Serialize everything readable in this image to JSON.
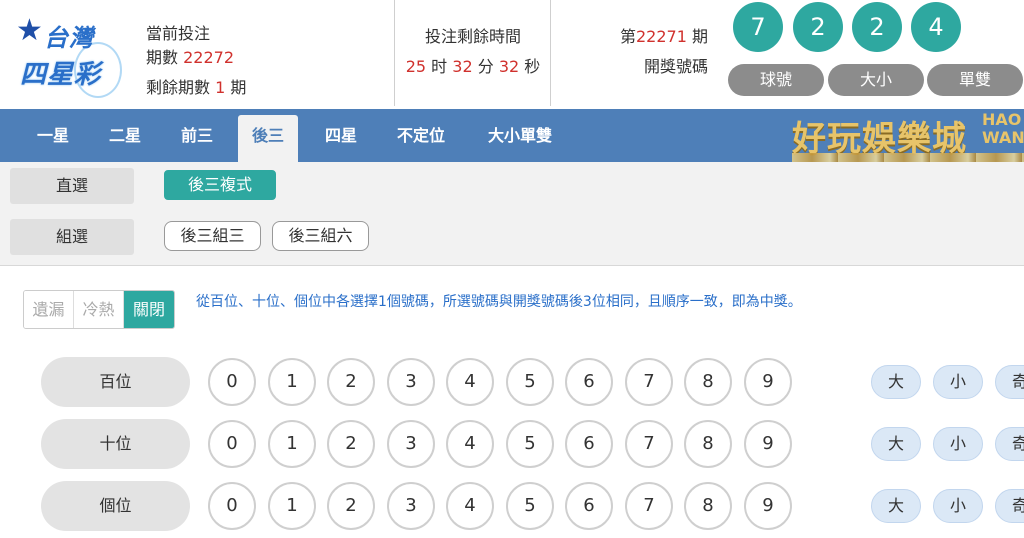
{
  "logo": {
    "line1": "台灣",
    "line2": "四星彩"
  },
  "current": {
    "label": "當前投注",
    "period_label": "期數",
    "period": "22272",
    "remaining_label": "剩餘期數",
    "remaining": "1",
    "remaining_unit": "期"
  },
  "timer": {
    "label": "投注剩餘時間",
    "hours": "25",
    "hours_unit": "时",
    "minutes": "32",
    "minutes_unit": "分",
    "seconds": "32",
    "seconds_unit": "秒"
  },
  "last_draw": {
    "prefix": "第",
    "period": "22271",
    "suffix": "期",
    "label": "開獎號碼",
    "balls": [
      "7",
      "2",
      "2",
      "4"
    ],
    "buttons": [
      "球號",
      "大小",
      "單雙"
    ]
  },
  "nav": {
    "tabs": [
      "一星",
      "二星",
      "前三",
      "後三",
      "四星",
      "不定位",
      "大小單雙"
    ],
    "active": "後三"
  },
  "casino": {
    "cn": "好玩娛樂城",
    "en1": "HAO",
    "en2": "WAN"
  },
  "play_types": {
    "direct": {
      "label": "直選",
      "options": [
        "後三複式"
      ]
    },
    "group": {
      "label": "組選",
      "options": [
        "後三組三",
        "後三組六"
      ]
    }
  },
  "toggle": {
    "items": [
      "遺漏",
      "冷熱",
      "關閉"
    ],
    "active": "關閉"
  },
  "hint": "從百位、十位、個位中各選擇1個號碼，所選號碼與開獎號碼後3位相同，且順序一致，即為中獎。",
  "positions": {
    "rows": [
      "百位",
      "十位",
      "個位"
    ],
    "digits": [
      "0",
      "1",
      "2",
      "3",
      "4",
      "5",
      "6",
      "7",
      "8",
      "9"
    ],
    "quick": [
      "大",
      "小",
      "奇"
    ]
  },
  "colors": {
    "accent": "#2ea8a0",
    "nav": "#4e7fb8",
    "red": "#d0312d",
    "hint": "#2a6fc9"
  }
}
